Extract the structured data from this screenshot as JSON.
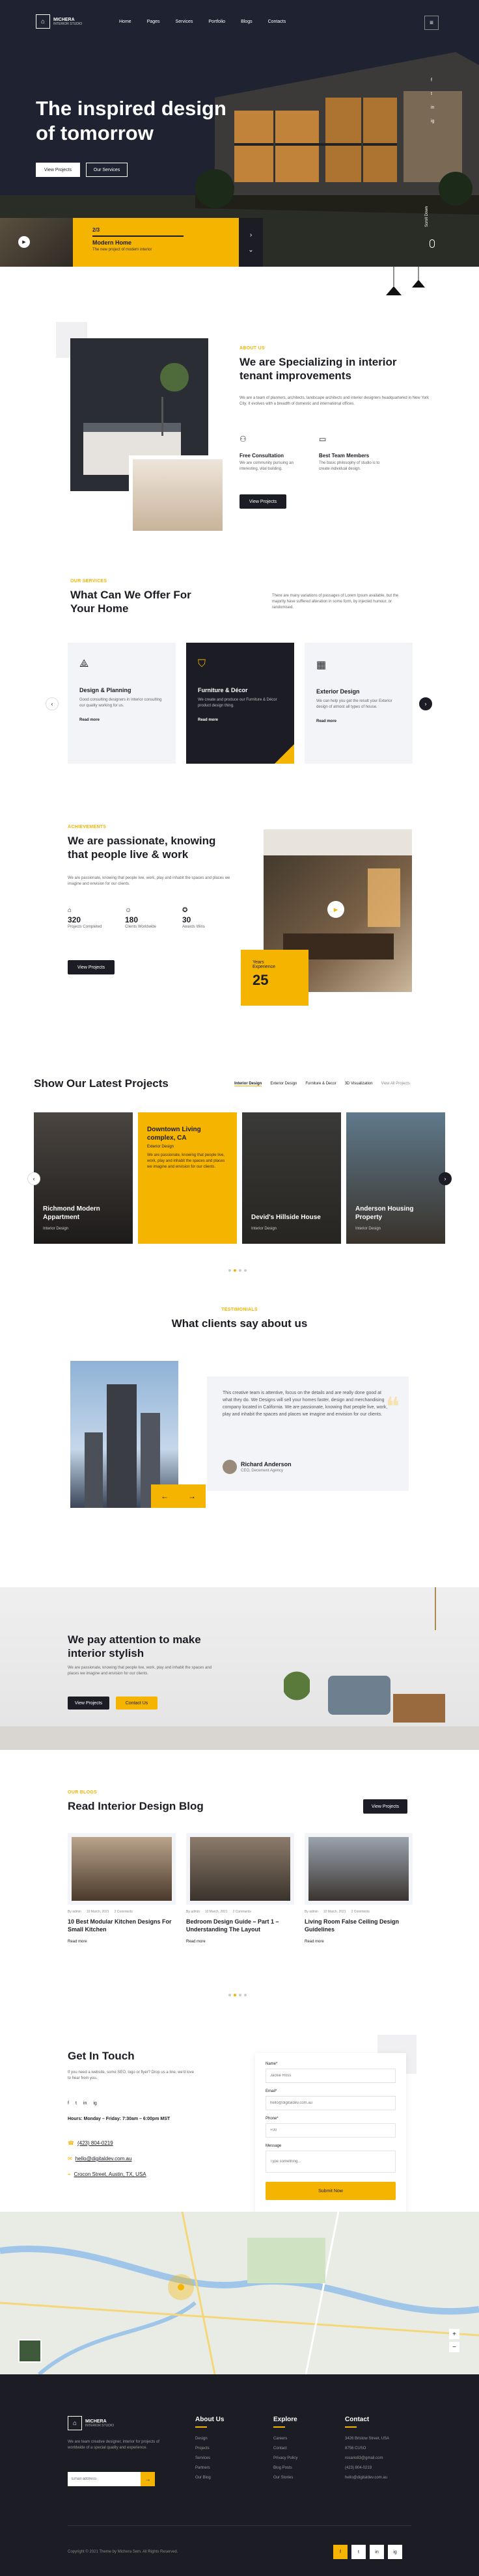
{
  "colors": {
    "accent": "#f5b400",
    "dark": "#1c1c24",
    "light": "#f3f4f8"
  },
  "brand": {
    "name": "MICHERA",
    "tagline": "INTERIOR STUDIO"
  },
  "nav": {
    "items": [
      "Home",
      "Pages",
      "Services",
      "Portfolio",
      "Blogs",
      "Contacts"
    ],
    "menu_icon": "menu-icon"
  },
  "hero": {
    "title": "The inspired design of tomorrow",
    "btn_projects": "View Projects",
    "btn_services": "Our Services",
    "slide_num": "2/3",
    "slide_title": "Modern Home",
    "slide_desc": "The new project of modern interior",
    "scroll_label": "Scroll Down",
    "social": [
      "f",
      "t",
      "in",
      "ig"
    ]
  },
  "specializing": {
    "sub": "ABOUT US",
    "title": "We are Specializing in interior tenant improvements",
    "desc": "We are a team of planners, architects, landscape architects and interior designers headquartered in New York City. It evolves with a breadth of domestic and international offices.",
    "feat1_title": "Free Consultation",
    "feat1_desc": "We are community pursuing an interesting, vital building.",
    "feat2_title": "Best Team Members",
    "feat2_desc": "The basic philosophy of studio is to create individual design.",
    "btn": "View Projects"
  },
  "services": {
    "sub": "OUR SERVICES",
    "title": "What Can We Offer For Your Home",
    "desc": "There are many variations of passages of Lorem Ipsum available, but the majority have suffered alteration in some form, by injected humour, or randomised.",
    "cards": [
      {
        "title": "Design & Planning",
        "desc": "Good consulting designers in Interior consulting our quality working for us.",
        "link": "Read more"
      },
      {
        "title": "Furniture & Décor",
        "desc": "We create and produce our Furniture & Décor product design thing.",
        "link": "Read more"
      },
      {
        "title": "Exterior Design",
        "desc": "We can help you get the result your Exterior design of almost all types of house.",
        "link": "Read more"
      }
    ]
  },
  "passionate": {
    "sub": "ACHIEVEMENTS",
    "title": "We are passionate, knowing that people live & work",
    "desc": "We are passionate, knowing that people live, work, play and inhabit the spaces and places we imagine and envision for our clients.",
    "stats": [
      {
        "num": "320",
        "label": "Projects Completed"
      },
      {
        "num": "180",
        "label": "Clients Worldwide"
      },
      {
        "num": "30",
        "label": "Awards Wins"
      }
    ],
    "btn": "View Projects",
    "years_label": "Years Experience",
    "years_num": "25"
  },
  "projects": {
    "title": "Show Our Latest Projects",
    "filters": [
      "Interior Design",
      "Exterior Design",
      "Furniture & Decor",
      "3D Visualization",
      "View All Projects"
    ],
    "items": [
      {
        "title": "Richmond Modern Appartment",
        "sub": "Interior Design"
      },
      {
        "title": "Downtown Living complex, CA",
        "sub": "Exterior Design",
        "desc": "We are passionate, knowing that people live, work, play and inhabit the spaces and places we imagine and envision for our clients."
      },
      {
        "title": "Devid's Hillside House",
        "sub": "Interior Design"
      },
      {
        "title": "Anderson Housing Property",
        "sub": "Interior Design"
      }
    ]
  },
  "testimonials": {
    "sub": "TESTIMONIALS",
    "title": "What clients say about us",
    "quote": "This creative team is attentive, focus on the details and are really done good at what they do. We Designs will sell your homes faster, design and merchandising company located in California. We are passionate, knowing that people live, work, play and inhabit the spaces and places we imagine and envision for our clients.",
    "name": "Richard Anderson",
    "role": "CEO, Decement Agency",
    "quote_mark": "❝"
  },
  "attention": {
    "title": "We pay attention to make interior stylish",
    "desc": "We are passionate, knowing that people live, work, play and inhabit the spaces and places we imagine and envision for our clients.",
    "btn1": "View Projects",
    "btn2": "Contact Us"
  },
  "blog": {
    "sub": "OUR BLOGS",
    "title": "Read Interior Design Blog",
    "btn": "View Projects",
    "posts": [
      {
        "title": "10 Best Modular Kitchen Designs For Small Kitchen",
        "author": "By admin",
        "date": "10 March, 2021",
        "comments": "2 Comments",
        "link": "Read more"
      },
      {
        "title": "Bedroom Design Guide – Part 1 – Understanding The Layout",
        "author": "By admin",
        "date": "10 March, 2021",
        "comments": "2 Comments",
        "link": "Read more"
      },
      {
        "title": "Living Room False Ceiling Design Guidelines",
        "author": "By admin",
        "date": "10 March, 2021",
        "comments": "2 Comments",
        "link": "Read more"
      }
    ]
  },
  "contact": {
    "title": "Get In Touch",
    "desc": "If you need a website, some SEO, logo or flyer? Drop us a line, we'd love to hear from you.",
    "hours": "Hours: Monday – Friday: 7:30am – 6:00pm MST",
    "phone": "(423) 804-0219",
    "email": "hello@digitaldev.com.au",
    "address": "Crocon Street, Austin, TX, USA",
    "form": {
      "name_label": "Name*",
      "name_ph": "Jackie Ross",
      "email_label": "Email*",
      "email_ph": "hello@digitaldev.com.au",
      "phone_label": "Phone*",
      "phone_ph": "+00",
      "message_label": "Message",
      "message_ph": "Type something...",
      "submit": "Submit Now"
    }
  },
  "footer": {
    "desc": "We are team creative designer, interior for projects of worldwide of a special quality and experience.",
    "email_ph": "Email address",
    "about_title": "About Us",
    "about_links": [
      "Design",
      "Projects",
      "Services",
      "Partners",
      "Our Blog"
    ],
    "explore_title": "Explore",
    "explore_links": [
      "Careers",
      "Contact",
      "Privacy Policy",
      "Blog Posts",
      "Our Stories"
    ],
    "contact_title": "Contact",
    "contact_lines": [
      "3426 Bristow Street, USA",
      "8756 CUSO",
      "rosario83@gmail.com",
      "(423) 804-0219",
      "hello@digitaldev.com.au"
    ],
    "copyright": "Copyright © 2021 Theme by Michera Sem. All Rights Reserved."
  }
}
